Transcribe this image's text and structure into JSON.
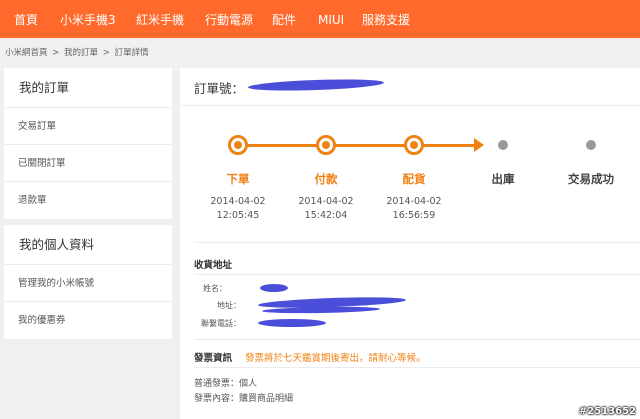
{
  "nav": {
    "items": [
      "首頁",
      "小米手機3",
      "紅米手機",
      "行動電源",
      "配件",
      "MIUI",
      "服務支援"
    ]
  },
  "breadcrumb": [
    "小米網首頁",
    ">",
    "我的訂單",
    ">",
    "訂單詳情"
  ],
  "sidebar": {
    "orders": {
      "title": "我的訂單",
      "items": [
        "交易訂單",
        "已關閉訂單",
        "退款單"
      ]
    },
    "profile": {
      "title": "我的個人資料",
      "items": [
        "管理我的小米帳號",
        "我的優惠券"
      ]
    }
  },
  "order": {
    "number_label": "訂單號："
  },
  "progress": {
    "steps": [
      {
        "label": "下單",
        "date": "2014-04-02",
        "time": "12:05:45",
        "done": true
      },
      {
        "label": "付款",
        "date": "2014-04-02",
        "time": "15:42:04",
        "done": true
      },
      {
        "label": "配貨",
        "date": "2014-04-02",
        "time": "16:56:59",
        "done": true
      },
      {
        "label": "出庫",
        "done": false
      },
      {
        "label": "交易成功",
        "done": false
      }
    ]
  },
  "shipping": {
    "title": "收貨地址",
    "name_label": "姓名：",
    "address_label": "地址：",
    "phone_label": "聯繫電話："
  },
  "invoice": {
    "title": "發票資訊",
    "note": "發票將於七天鑑賞期後寄出，請耐心等候。",
    "type": "普通發票：個人",
    "content": "發票內容：購買商品明細"
  },
  "watermark": "#2513652",
  "colors": {
    "accent": "#ff6a2c",
    "progress": "#f08214",
    "redaction": "#3b3fd6"
  }
}
